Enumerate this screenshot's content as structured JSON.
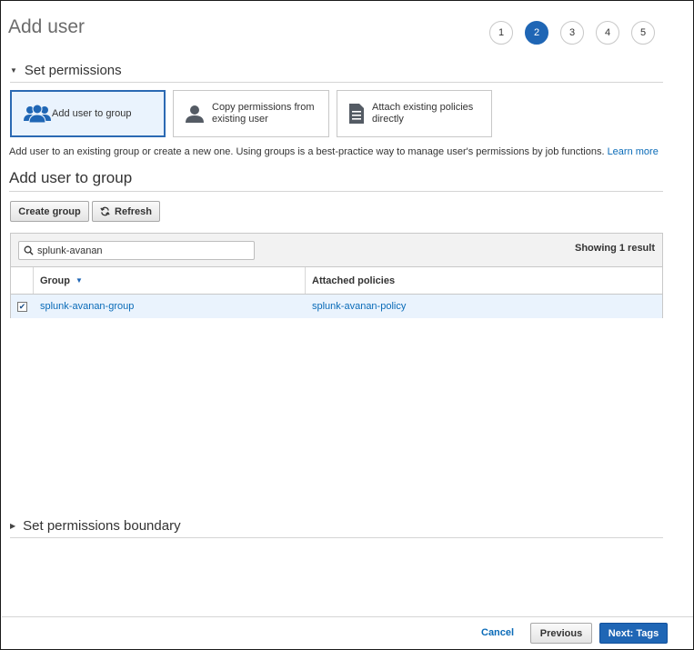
{
  "header": {
    "title": "Add user"
  },
  "steps": {
    "items": [
      "1",
      "2",
      "3",
      "4",
      "5"
    ],
    "active": "2"
  },
  "permissions": {
    "heading": "Set permissions",
    "options": [
      {
        "label": "Add user to group",
        "icon": "users-group-icon",
        "selected": true
      },
      {
        "label_line1": "Copy permissions from",
        "label_line2": "existing user",
        "icon": "user-icon"
      },
      {
        "label_line1": "Attach existing policies",
        "label_line2": "directly",
        "icon": "document-icon"
      }
    ],
    "description": "Add user to an existing group or create a new one. Using groups is a best-practice way to manage user's permissions by job functions.",
    "learn_more": "Learn more"
  },
  "group_section": {
    "heading": "Add user to group",
    "create_group": "Create group",
    "refresh": "Refresh",
    "search_value": "splunk-avanan",
    "showing": "Showing 1 result",
    "columns": {
      "group": "Group",
      "policies": "Attached policies"
    },
    "rows": [
      {
        "group": "splunk-avanan-group",
        "policy": "splunk-avanan-policy",
        "checked": true
      }
    ]
  },
  "boundary": {
    "heading": "Set permissions boundary"
  },
  "footer": {
    "cancel": "Cancel",
    "previous": "Previous",
    "next": "Next: Tags"
  },
  "colors": {
    "accent": "#1f66b5",
    "link": "#0a6bb8",
    "selected_bg": "#eaf3fd"
  }
}
